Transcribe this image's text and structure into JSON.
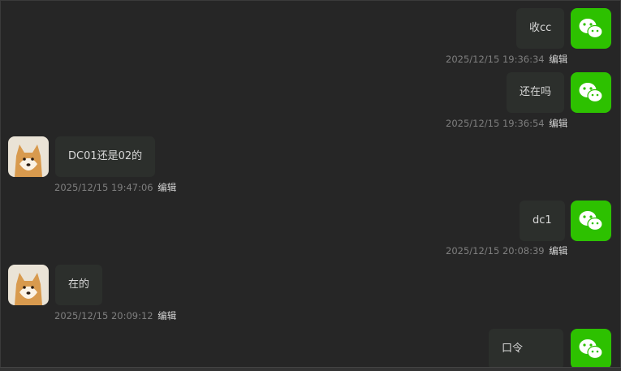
{
  "colors": {
    "background": "#262626",
    "bubble": "#2c2f2c",
    "wechat_green": "#2dc100",
    "timestamp": "#7f7f7f"
  },
  "messages": [
    {
      "side": "right",
      "text": "收cc",
      "time": "2025/12/15 19:36:34",
      "action": "编辑",
      "avatar": "wechat-icon"
    },
    {
      "side": "right",
      "text": "还在吗",
      "time": "2025/12/15 19:36:54",
      "action": "编辑",
      "avatar": "wechat-icon"
    },
    {
      "side": "left",
      "text": "DC01还是02的",
      "time": "2025/12/15 19:47:06",
      "action": "编辑",
      "avatar": "shiba-dog-avatar"
    },
    {
      "side": "right",
      "text": "dc1",
      "time": "2025/12/15 20:08:39",
      "action": "编辑",
      "avatar": "wechat-icon"
    },
    {
      "side": "left",
      "text": "在的",
      "time": "2025/12/15 20:09:12",
      "action": "编辑",
      "avatar": "shiba-dog-avatar"
    },
    {
      "side": "right",
      "text": "口令",
      "time": "",
      "action": "",
      "avatar": "wechat-icon"
    }
  ]
}
